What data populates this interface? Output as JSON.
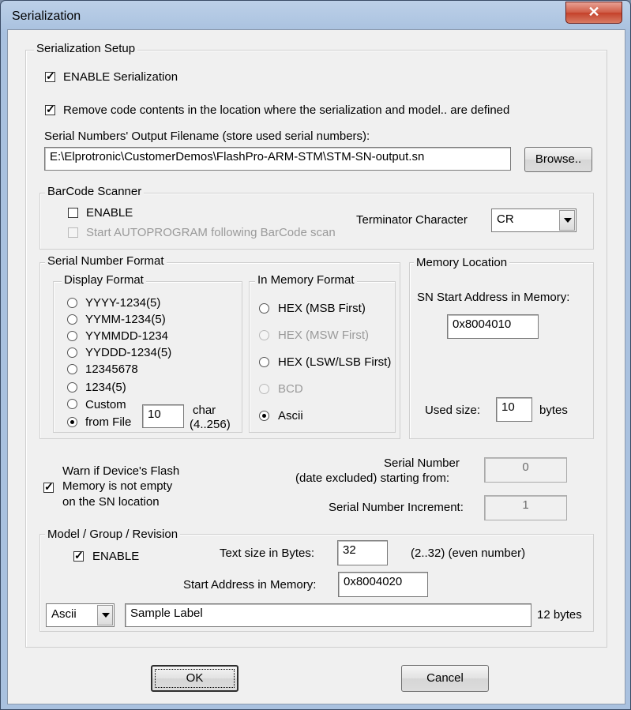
{
  "window": {
    "title": "Serialization",
    "close_glyph": "✕"
  },
  "setup": {
    "legend": "Serialization Setup",
    "enable_label": "ENABLE Serialization",
    "remove_label": "Remove code contents in the location where the serialization and model.. are defined",
    "output_label": "Serial Numbers' Output Filename (store used serial numbers):",
    "output_value": "E:\\Elprotronic\\CustomerDemos\\FlashPro-ARM-STM\\STM-SN-output.sn",
    "browse_label": "Browse.."
  },
  "barcode": {
    "legend": "BarCode Scanner",
    "enable_label": "ENABLE",
    "autoprogram_label": "Start AUTOPROGRAM following BarCode scan",
    "terminator_label": "Terminator Character",
    "terminator_value": "CR"
  },
  "format": {
    "legend": "Serial Number Format",
    "display_legend": "Display Format",
    "display_options": [
      "YYYY-1234(5)",
      "YYMM-1234(5)",
      "YYMMDD-1234",
      "YYDDD-1234(5)",
      "12345678",
      "1234(5)"
    ],
    "custom_label1": "Custom",
    "custom_label2": "from File",
    "char_value": "10",
    "char_label": "char",
    "char_range": "(4..256)",
    "memory_legend": "In Memory Format",
    "memory_options": [
      "HEX (MSB First)",
      "HEX (MSW First)",
      "HEX (LSW/LSB First)",
      "BCD",
      "Ascii"
    ]
  },
  "memory_location": {
    "legend": "Memory Location",
    "start_label": "SN Start Address in Memory:",
    "start_value": "0x8004010",
    "used_label": "Used size:",
    "used_value": "10",
    "used_unit": "bytes"
  },
  "warn": {
    "line1": "Warn if Device's Flash",
    "line2": "Memory is not empty",
    "line3": "on the SN location"
  },
  "serial": {
    "start_label1": "Serial Number",
    "start_label2": "(date excluded) starting  from:",
    "start_value": "0",
    "increment_label": "Serial Number Increment:",
    "increment_value": "1"
  },
  "model": {
    "legend": "Model / Group / Revision",
    "enable_label": "ENABLE",
    "text_size_label": "Text size in Bytes:",
    "text_size_value": "32",
    "text_size_hint": "(2..32) (even number)",
    "start_label": "Start Address in Memory:",
    "start_value": "0x8004020",
    "encoding_value": "Ascii",
    "label_value": "Sample Label",
    "bytes_label": "12 bytes"
  },
  "buttons": {
    "ok": "OK",
    "cancel": "Cancel"
  }
}
